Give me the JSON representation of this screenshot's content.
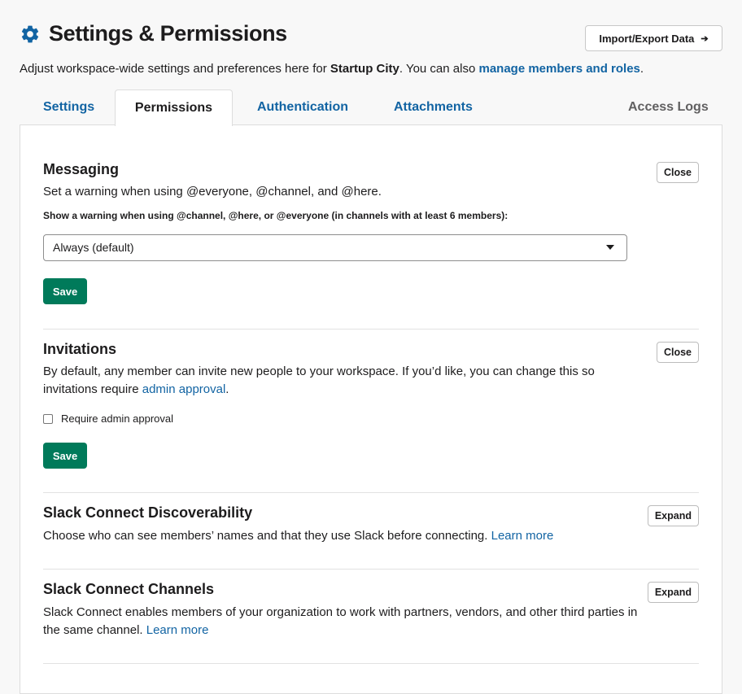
{
  "header": {
    "title": "Settings & Permissions",
    "import_button": "Import/Export Data",
    "import_arrow": "➔"
  },
  "subtitle": {
    "prefix": "Adjust workspace-wide settings and preferences here for ",
    "workspace": "Startup City",
    "middle": ". You can also ",
    "link": "manage members and roles",
    "suffix": "."
  },
  "tabs": [
    {
      "label": "Settings"
    },
    {
      "label": "Permissions",
      "active": true
    },
    {
      "label": "Authentication"
    },
    {
      "label": "Attachments"
    },
    {
      "label": "Access Logs"
    }
  ],
  "messaging": {
    "title": "Messaging",
    "button": "Close",
    "description": "Set a warning when using @everyone, @channel, and @here.",
    "field_label": "Show a warning when using @channel, @here, or @everyone (in channels with at least 6 members):",
    "select_value": "Always (default)",
    "save": "Save"
  },
  "invitations": {
    "title": "Invitations",
    "button": "Close",
    "description_prefix": "By default, any member can invite new people to your workspace. If you’d like, you can change this so invitations require ",
    "description_link": "admin approval",
    "description_suffix": ".",
    "checkbox_label": "Require admin approval",
    "checkbox_checked": false,
    "save": "Save"
  },
  "discoverability": {
    "title": "Slack Connect Discoverability",
    "button": "Expand",
    "description": "Choose who can see members’ names and that they use Slack before connecting.",
    "link": "Learn more"
  },
  "channels": {
    "title": "Slack Connect Channels",
    "button": "Expand",
    "description": "Slack Connect enables members of your organization to work with partners, vendors, and other third parties in the same channel.",
    "link": "Learn more"
  },
  "colors": {
    "accent": "#1264a3",
    "primary_button": "#007a5a",
    "gear_icon": "#1264a3"
  }
}
